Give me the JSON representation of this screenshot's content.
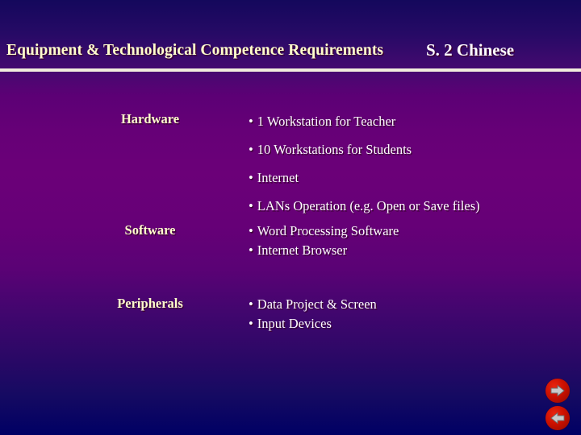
{
  "slide": {
    "title": "Equipment & Technological Competence Requirements",
    "subtitle": "S. 2 Chinese",
    "colors": {
      "title_text": "#ffffcc",
      "subtitle_text": "#ffffff",
      "body_text": "#ffffff",
      "label_text": "#ffffcc",
      "rule": "#f2eede",
      "background_top": "#14085c",
      "background_mid": "#6b0078",
      "background_bottom": "#000064",
      "nav_button": "#cc1000",
      "nav_arrow": "#b0b0b0"
    }
  },
  "sections": [
    {
      "label": "Hardware",
      "bullets": [
        "1 Workstation for Teacher",
        "10 Workstations for Students",
        "Internet",
        "LANs Operation (e.g. Open or Save files)"
      ]
    },
    {
      "label": "Software",
      "bullets": [
        "Word Processing Software",
        "Internet Browser"
      ]
    },
    {
      "label": "Peripherals",
      "bullets": [
        "Data Project & Screen",
        "Input Devices"
      ]
    }
  ],
  "bullet_glyph": "•",
  "navigation": {
    "forward_label": "forward-arrow-icon",
    "back_label": "back-arrow-icon"
  }
}
